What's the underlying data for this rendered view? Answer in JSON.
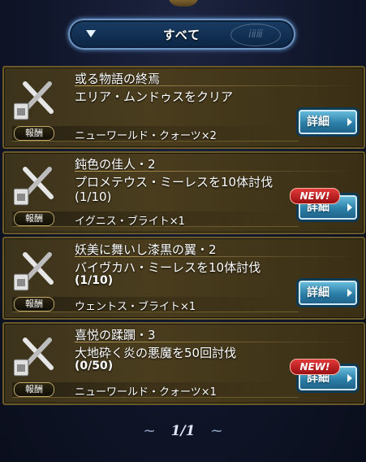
{
  "filter": {
    "label": "すべて",
    "emblem_text": "ⅰⅱⅲ"
  },
  "missions": [
    {
      "title": "或る物語の終焉",
      "desc_line1": "エリア・ムンドゥスをクリア",
      "desc_line2": "",
      "reward_tag": "報酬",
      "reward": "ニューワールド・クォーツ×2",
      "detail": "詳細",
      "new": ""
    },
    {
      "title": "鈍色の佳人・2",
      "desc_line1": "プロメテウス・ミーレスを10体討伐(1/10)",
      "desc_line2": "",
      "reward_tag": "報酬",
      "reward": "イグニス・ブライト×1",
      "detail": "詳細",
      "new": "NEW!"
    },
    {
      "title": "妖美に舞いし漆黒の翼・2",
      "desc_line1": "バイヴカハ・ミーレスを10体討伐",
      "desc_line2": "(1/10)",
      "reward_tag": "報酬",
      "reward": "ウェントス・ブライト×1",
      "detail": "詳細",
      "new": ""
    },
    {
      "title": "喜悦の蹂躙・3",
      "desc_line1": "大地砕く炎の悪魔を50回討伐",
      "desc_line2": "(0/50)",
      "reward_tag": "報酬",
      "reward": "ニューワールド・クォーツ×1",
      "detail": "詳細",
      "new": "NEW!"
    }
  ],
  "pager": {
    "text": "1/1"
  },
  "colors": {
    "card_border": "#6b5a2a",
    "detail_button": "#2b7fa8",
    "new_badge": "#e23a3a"
  }
}
